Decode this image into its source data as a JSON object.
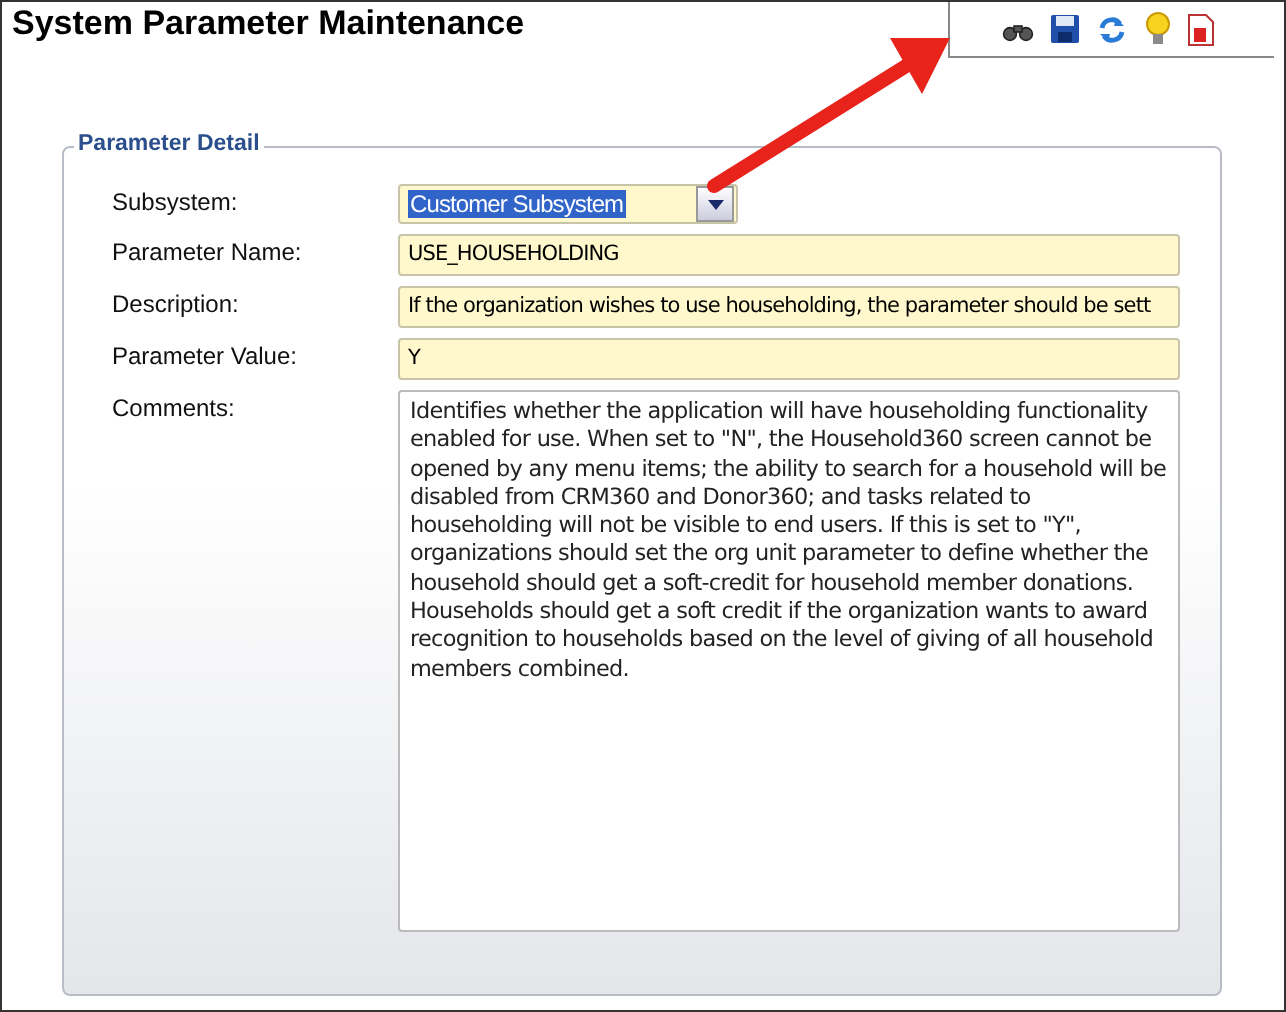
{
  "window": {
    "title": "System Parameter Maintenance"
  },
  "toolbar": {
    "buttons": [
      {
        "kind": "binoculars"
      },
      {
        "kind": "save"
      },
      {
        "kind": "refresh"
      },
      {
        "kind": "bulb"
      },
      {
        "kind": "report"
      }
    ]
  },
  "panel": {
    "title": "Parameter Detail",
    "fields": [
      {
        "kind": "dropdown",
        "label": "Subsystem:",
        "value": "Customer Subsystem",
        "text_selected": true
      },
      {
        "kind": "text",
        "label": "Parameter Name:",
        "value": "USE_HOUSEHOLDING"
      },
      {
        "kind": "text",
        "label": "Description:",
        "value": "If the organization wishes to use householding, the parameter should be sett"
      },
      {
        "kind": "text",
        "label": "Parameter Value:",
        "value": "Y"
      },
      {
        "kind": "textarea",
        "label": "Comments:",
        "value": "Identifies whether the application will have householding functionality enabled for use. When set to \"N\", the Household360 screen cannot be opened by any menu items; the ability to search for a household will be disabled from CRM360 and Donor360; and tasks related to householding will not be visible to end users.  If this is set to \"Y\", organizations should set the org unit parameter to define whether the household should get a soft-credit for household member donations. Households should get a soft credit if the organization wants to award recognition to households based on the level of giving of all household members combined."
      }
    ]
  }
}
